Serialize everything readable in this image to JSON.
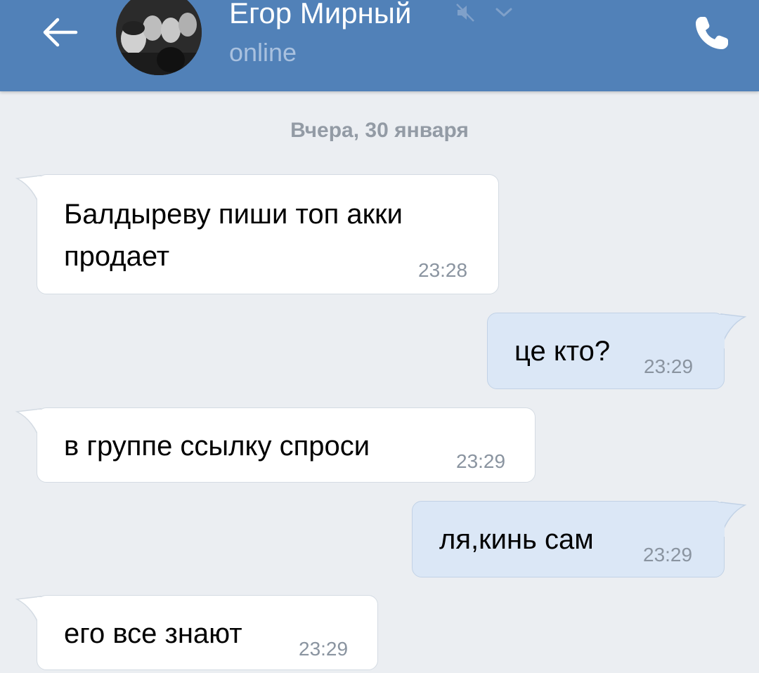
{
  "header": {
    "contact_name": "Егор Мирный",
    "status": "online",
    "icons": {
      "back": "arrow-left-icon",
      "mute": "muted-speaker-icon",
      "dropdown": "chevron-down-icon",
      "call": "phone-icon"
    },
    "colors": {
      "bar": "#5181b8",
      "status": "#a9c1df"
    }
  },
  "date_divider": "Вчера, 30 января",
  "messages": [
    {
      "direction": "in",
      "lines": [
        "Балдыреву пиши топ акки",
        "продает"
      ],
      "time": "23:28"
    },
    {
      "direction": "out",
      "lines": [
        "це кто?"
      ],
      "time": "23:29"
    },
    {
      "direction": "in",
      "lines": [
        "в группе ссылку спроси"
      ],
      "time": "23:29"
    },
    {
      "direction": "out",
      "lines": [
        "ля,кинь сам"
      ],
      "time": "23:29"
    },
    {
      "direction": "in",
      "lines": [
        "его все знают"
      ],
      "time": "23:29"
    }
  ],
  "colors": {
    "background": "#ebeef2",
    "incoming_bubble": "#ffffff",
    "outgoing_bubble": "#dbe7f6"
  }
}
